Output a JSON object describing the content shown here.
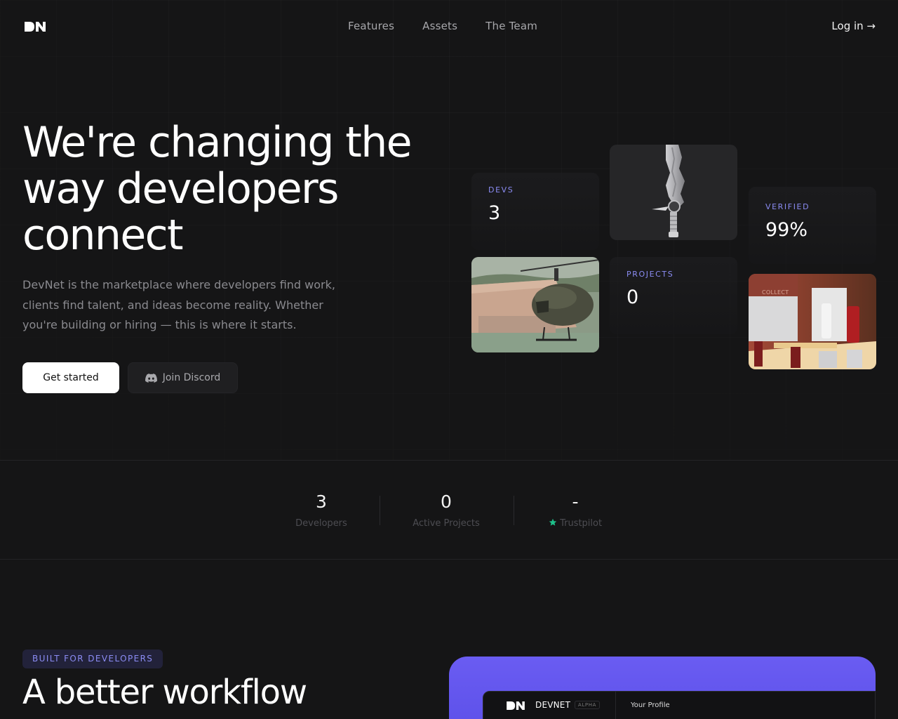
{
  "nav": {
    "logo_text": "DN",
    "links": [
      "Features",
      "Assets",
      "The Team"
    ],
    "login_label": "Log in →"
  },
  "hero": {
    "title": "We're changing the way developers connect",
    "subtitle": "DevNet is the marketplace where developers find work, clients find talent, and ideas become reality. Whether you're building or hiring — this is where it starts.",
    "primary_button": "Get started",
    "secondary_button": "Join Discord"
  },
  "cards": {
    "devs": {
      "label": "DEVS",
      "value": "3"
    },
    "verified": {
      "label": "VERIFIED",
      "value": "99%"
    },
    "projects": {
      "label": "PROJECTS",
      "value": "0"
    },
    "collect_sign": "COLLECT"
  },
  "stats": [
    {
      "value": "3",
      "label": "Developers"
    },
    {
      "value": "0",
      "label": "Active Projects"
    },
    {
      "value": "-",
      "label": "Trustpilot"
    }
  ],
  "section": {
    "badge": "BUILT FOR DEVELOPERS",
    "title": "A better workflow"
  },
  "preview": {
    "app_name": "DEVNET",
    "app_badge": "ALPHA",
    "profile_label": "Your Profile"
  },
  "colors": {
    "background": "#151516",
    "accent": "#8b8cf3",
    "preview_accent": "#6a5cf2",
    "trustpilot": "#1ec08a"
  }
}
